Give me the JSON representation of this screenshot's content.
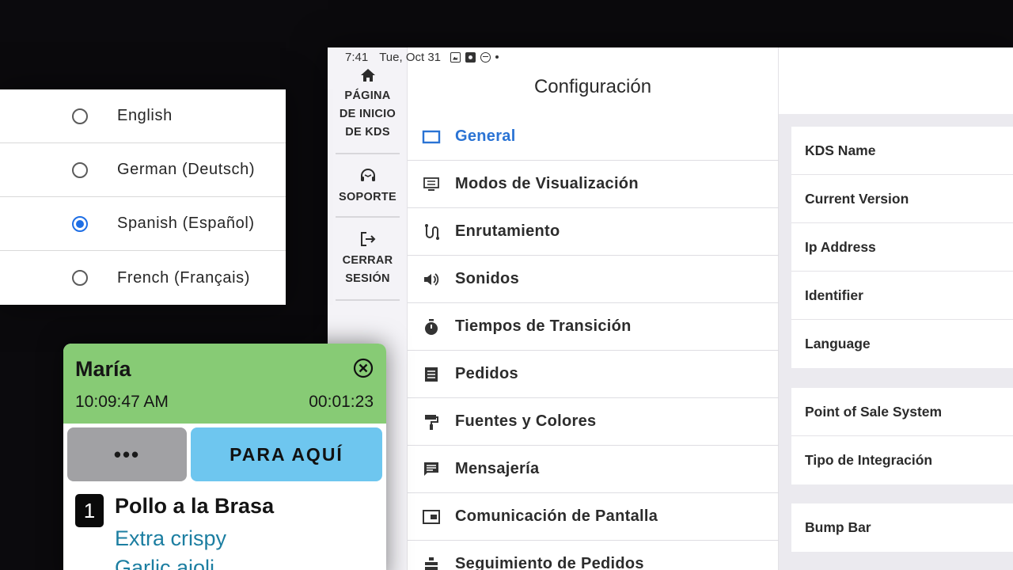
{
  "status_bar": {
    "time": "7:41",
    "date": "Tue, Oct 31"
  },
  "sidebar": {
    "home_label": "PÁGINA DE INICIO DE KDS",
    "support_label": "SOPORTE",
    "logout_label": "CERRAR SESIÓN"
  },
  "settings": {
    "title": "Configuración",
    "menu": [
      {
        "label": "General",
        "icon": "tablet-icon",
        "active": true
      },
      {
        "label": "Modos de Visualización",
        "icon": "display-modes-icon"
      },
      {
        "label": "Enrutamiento",
        "icon": "routing-icon"
      },
      {
        "label": "Sonidos",
        "icon": "speaker-icon"
      },
      {
        "label": "Tiempos de Transición",
        "icon": "stopwatch-icon"
      },
      {
        "label": "Pedidos",
        "icon": "receipt-icon"
      },
      {
        "label": "Fuentes y Colores",
        "icon": "paint-roller-icon"
      },
      {
        "label": "Mensajería",
        "icon": "message-icon"
      },
      {
        "label": "Comunicación de Pantalla",
        "icon": "screen-icon"
      },
      {
        "label": "Seguimiento de Pedidos",
        "icon": "tracking-icon"
      }
    ],
    "active_color": "#2a73d4"
  },
  "details": {
    "group1": [
      "KDS Name",
      "Current Version",
      "Ip Address",
      "Identifier",
      "Language"
    ],
    "group2": [
      "Point of Sale System",
      "Tipo de Integración"
    ],
    "group3": [
      "Bump Bar"
    ]
  },
  "languages": {
    "options": [
      "English",
      "German (Deutsch)",
      "Spanish (Español)",
      "French (Français)"
    ],
    "selected": "Spanish (Español)",
    "accent": "#1f6fe5"
  },
  "ticket": {
    "customer": "María",
    "time": "10:09:47 AM",
    "elapsed": "00:01:23",
    "more_label": "•••",
    "order_type": "PARA AQUÍ",
    "quantity": "1",
    "item": "Pollo a la Brasa",
    "modifiers": [
      "Extra crispy",
      "Garlic aioli"
    ],
    "header_color": "#87cb75",
    "order_type_color": "#6ec6ef",
    "modifier_color": "#1c7ea1"
  }
}
